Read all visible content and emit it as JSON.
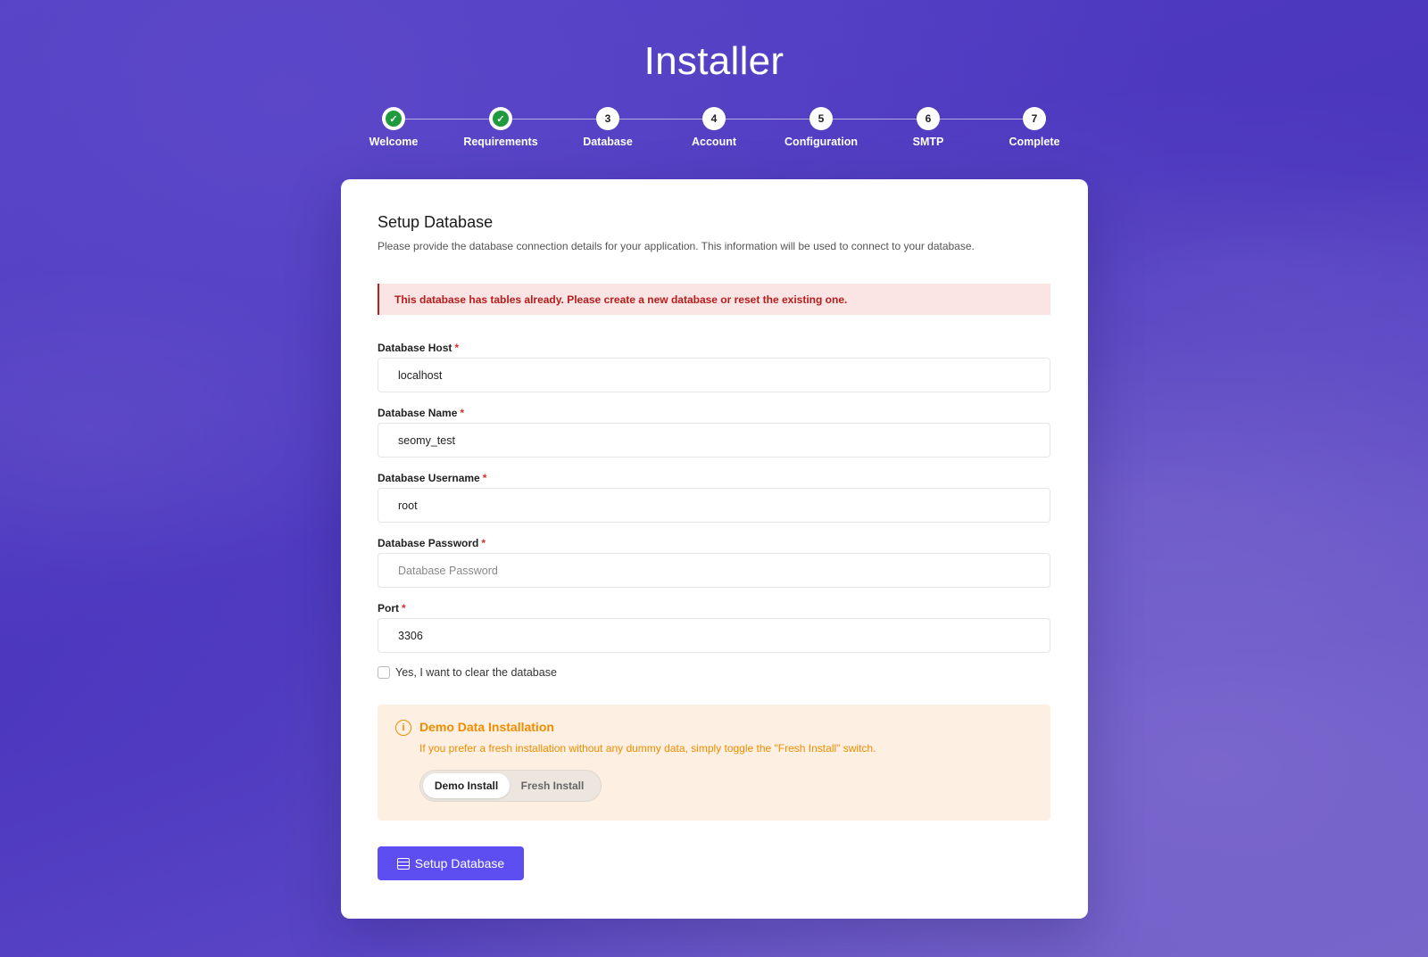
{
  "page": {
    "title": "Installer"
  },
  "steps": [
    {
      "number": "1",
      "label": "Welcome",
      "status": "done"
    },
    {
      "number": "2",
      "label": "Requirements",
      "status": "done"
    },
    {
      "number": "3",
      "label": "Database",
      "status": "current"
    },
    {
      "number": "4",
      "label": "Account",
      "status": "pending"
    },
    {
      "number": "5",
      "label": "Configuration",
      "status": "pending"
    },
    {
      "number": "6",
      "label": "SMTP",
      "status": "pending"
    },
    {
      "number": "7",
      "label": "Complete",
      "status": "pending"
    }
  ],
  "card": {
    "title": "Setup Database",
    "description": "Please provide the database connection details for your application. This information will be used to connect to your database."
  },
  "alert": {
    "message": "This database has tables already. Please create a new database or reset the existing one."
  },
  "fields": {
    "host": {
      "label": "Database Host",
      "required": "*",
      "value": "localhost",
      "placeholder": ""
    },
    "name": {
      "label": "Database Name",
      "required": "*",
      "value": "seomy_test",
      "placeholder": ""
    },
    "username": {
      "label": "Database Username",
      "required": "*",
      "value": "root",
      "placeholder": ""
    },
    "password": {
      "label": "Database Password",
      "required": "*",
      "value": "",
      "placeholder": "Database Password"
    },
    "port": {
      "label": "Port",
      "required": "*",
      "value": "3306",
      "placeholder": ""
    }
  },
  "clear_checkbox": {
    "label": "Yes, I want to clear the database",
    "checked": false
  },
  "demo": {
    "icon": "info-icon",
    "title": "Demo Data Installation",
    "description": "If you prefer a fresh installation without any dummy data, simply toggle the \"Fresh Install\" switch.",
    "options": [
      "Demo Install",
      "Fresh Install"
    ],
    "selected": "Demo Install"
  },
  "submit": {
    "label": "Setup Database",
    "icon": "database-icon"
  },
  "colors": {
    "accent": "#5c4ef0",
    "success": "#1f9a3c",
    "error": "#b71c1c",
    "warning": "#f08c00"
  }
}
